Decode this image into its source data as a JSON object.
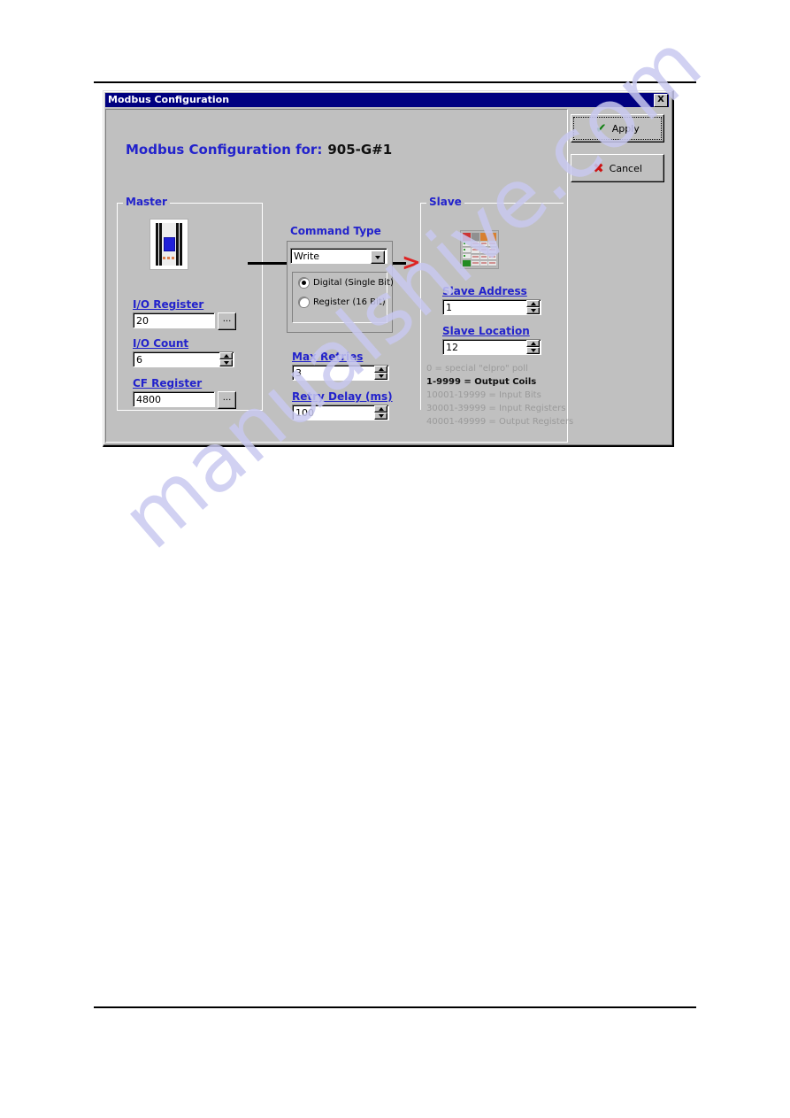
{
  "window": {
    "title": "Modbus Configuration",
    "close_label": "X",
    "heading_prefix": "Modbus Configuration for:",
    "heading_device": "905-G#1"
  },
  "master": {
    "group_label": "Master",
    "icon": "plc-module-icon",
    "fields": [
      {
        "label": "I/O Register",
        "value": "20",
        "browse_label": "...",
        "type": "text-browse"
      },
      {
        "label": "I/O Count",
        "value": "6",
        "type": "spinner"
      },
      {
        "label": "CF Register",
        "value": "4800",
        "browse_label": "...",
        "type": "text-browse"
      }
    ]
  },
  "command": {
    "title": "Command Type",
    "selected_type": "Write",
    "dropdown_arrow": "▼",
    "options": [
      {
        "label": "Digital (Single Bit)",
        "selected": true
      },
      {
        "label": "Register (16 Bit)",
        "selected": false
      }
    ],
    "arrow_glyph": ">",
    "arrow_color": "#dd2222"
  },
  "timing": {
    "max_retries": {
      "label": "Max Retries",
      "value": "3"
    },
    "retry_delay": {
      "label": "Retry Delay (ms)",
      "value": "100"
    }
  },
  "slave": {
    "group_label": "Slave",
    "icon": "io-rack-icon",
    "address": {
      "label": "Slave Address",
      "value": "1"
    },
    "location": {
      "label": "Slave Location",
      "value": "12"
    },
    "legend": [
      {
        "text": "0 = special \"elpro\" poll",
        "active": false
      },
      {
        "text": "1-9999 = Output Coils",
        "active": true
      },
      {
        "text": "10001-19999 = Input Bits",
        "active": false
      },
      {
        "text": "30001-39999 = Input Registers",
        "active": false
      },
      {
        "text": "40001-49999 = Output Registers",
        "active": false
      }
    ]
  },
  "buttons": {
    "apply": {
      "label": "Apply",
      "glyph": "✔",
      "focused": true
    },
    "cancel": {
      "label": "Cancel",
      "glyph": "✖",
      "focused": false
    }
  },
  "watermark": {
    "text": "manualshive.com"
  },
  "colors": {
    "accent_blue": "#2222cc",
    "titlebar": "#000080",
    "face": "#c0c0c0",
    "arrow_red": "#dd2222",
    "check_green": "#108010"
  }
}
